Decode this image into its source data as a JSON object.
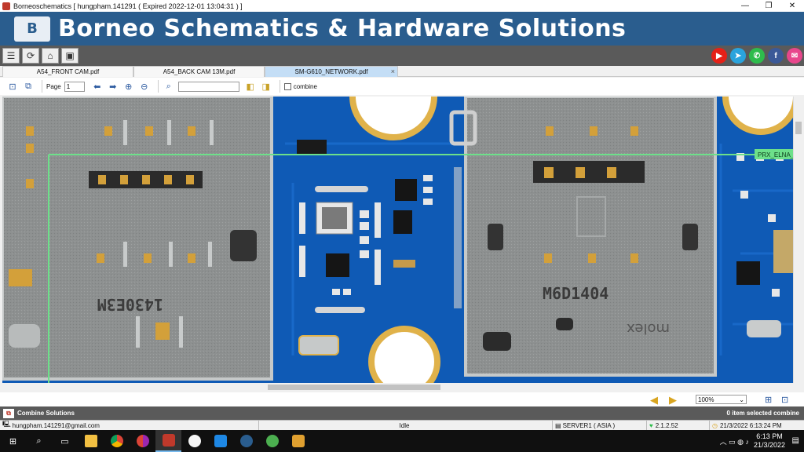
{
  "window": {
    "title": "Borneoschematics [ hungpham.141291 ( Expired 2022-12-01 13:04:31 ) ]",
    "minimize": "—",
    "maximize": "❐",
    "close": "✕"
  },
  "banner": {
    "logo_text": "B",
    "title": "Borneo Schematics & Hardware Solutions"
  },
  "toolbar_icons": [
    "menu-icon",
    "refresh-icon",
    "home-icon",
    "screen-icon"
  ],
  "social": [
    {
      "name": "youtube-icon",
      "color": "#e62117",
      "glyph": "▶"
    },
    {
      "name": "telegram-icon",
      "color": "#2aa3dc",
      "glyph": "➤"
    },
    {
      "name": "whatsapp-icon",
      "color": "#2ebc4c",
      "glyph": "✆"
    },
    {
      "name": "facebook-icon",
      "color": "#3b5998",
      "glyph": "f"
    },
    {
      "name": "messenger-icon",
      "color": "#e8468c",
      "glyph": "✉"
    }
  ],
  "tabs": [
    {
      "label": "A54_FRONT CAM.pdf",
      "active": false
    },
    {
      "label": "A54_BACK CAM 13M.pdf",
      "active": false
    },
    {
      "label": "SM-G610_NETWORK.pdf",
      "active": true,
      "close": "×"
    }
  ],
  "pdf_toolbar": {
    "page_label": "Page",
    "page_value": "1",
    "search_value": "",
    "combine_label": "combine"
  },
  "board": {
    "label_tag": "PRX_ELNA_",
    "marking_left": "1430E3M",
    "marking_right": "M6D1404",
    "marking_molex": "molex"
  },
  "nav": {
    "zoom": "100%"
  },
  "combine_bar": {
    "title": "Combine Solutions",
    "selected": "0 item selected combine"
  },
  "status": {
    "user": "hungpham.141291@gmail.com",
    "state": "Idle",
    "server": "SERVER1 ( ASIA )",
    "version": "2.1.2.52",
    "datetime": "21/3/2022 6:13:24 PM"
  },
  "taskbar": {
    "time": "6:13 PM",
    "date": "21/3/2022",
    "apps": [
      "windows-icon",
      "search-icon",
      "task-view-icon",
      "file-explorer-icon",
      "chrome-icon",
      "chrome-profile-icon",
      "borneo-app-icon",
      "itunes-icon",
      "app3-icon",
      "app-blue-icon",
      "app-green-icon",
      "app-lion-icon"
    ]
  },
  "colors": {
    "banner": "#2a5d8e",
    "board_blue": "#0f5ab5",
    "shield": "#8b8e8e",
    "trace_line": "#6de08a"
  }
}
